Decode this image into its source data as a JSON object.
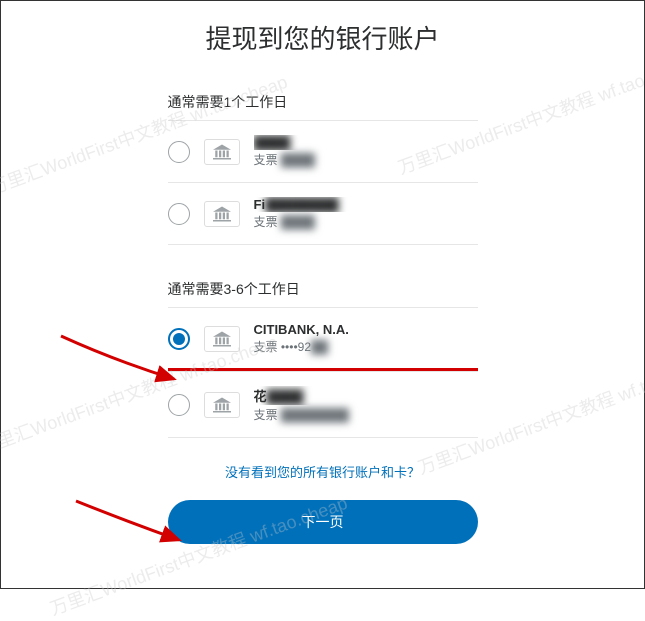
{
  "title": "提现到您的银行账户",
  "sections": [
    {
      "label": "通常需要1个工作日",
      "options": [
        {
          "name_masked": "████",
          "sub_prefix": "支票",
          "sub_masked": "████",
          "selected": false
        },
        {
          "name_prefix": "Fi",
          "name_masked": "████████",
          "sub_prefix": "支票",
          "sub_masked": "████",
          "selected": false
        }
      ]
    },
    {
      "label": "通常需要3-6个工作日",
      "options": [
        {
          "name": "CITIBANK, N.A.",
          "sub": "支票 ••••92",
          "sub_masked": "██",
          "selected": true,
          "underlined": true
        },
        {
          "name_prefix": "花",
          "name_masked": "████",
          "sub_prefix": "支票",
          "sub_masked": "████████",
          "selected": false
        }
      ]
    }
  ],
  "link_text": "没有看到您的所有银行账户和卡？",
  "button_label": "下一页",
  "watermark": "万里汇WorldFirst中文教程 wf.tao.cheap"
}
